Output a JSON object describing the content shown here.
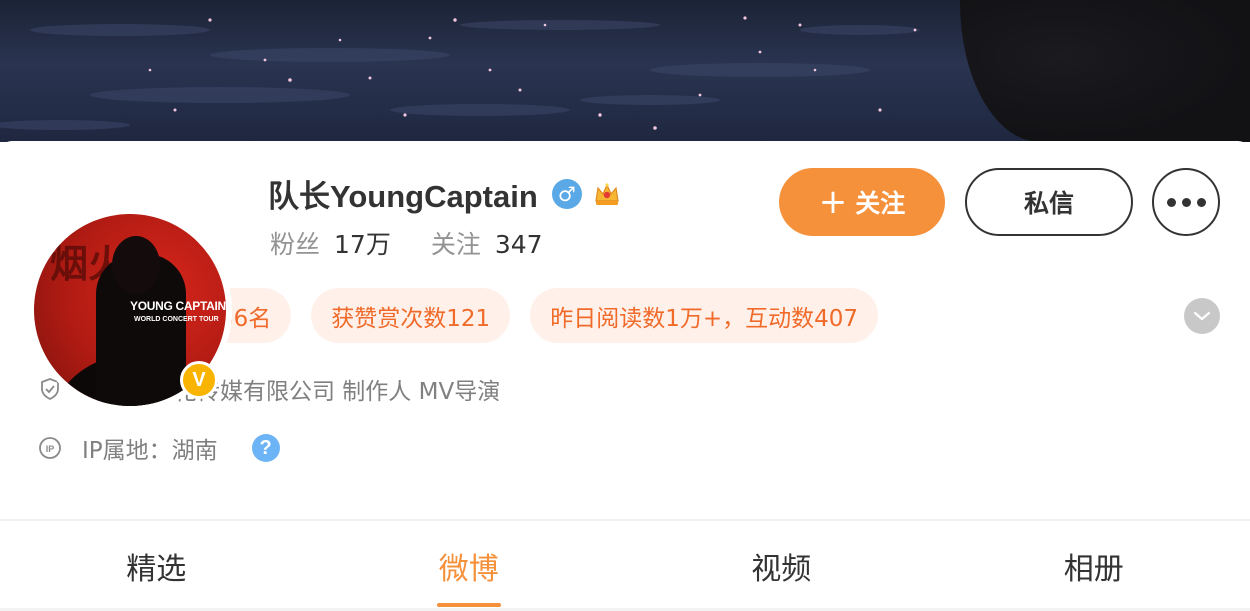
{
  "profile": {
    "name": "队长YoungCaptain",
    "gender_symbol": "♂",
    "verified_badge": "V",
    "avatar": {
      "poster_title": "YOUNG CAPTAIN",
      "poster_subtitle": "WORLD CONCERT TOUR",
      "calligraphy": "烟火"
    }
  },
  "stats": {
    "followers_label": "粉丝",
    "followers_value": "17万",
    "following_label": "关注",
    "following_value": "347"
  },
  "actions": {
    "follow_label": "关注",
    "follow_plus": "+",
    "message_label": "私信"
  },
  "tags": [
    "视频号音乐榜第56名",
    "获赞赏次数121",
    "昨日阅读数1万+，互动数407"
  ],
  "info": {
    "company": "纽曼尼文化传媒有限公司 制作人 MV导演",
    "ip_location": "IP属地：湖南",
    "help_symbol": "?"
  },
  "tabs": [
    {
      "label": "精选",
      "active": false
    },
    {
      "label": "微博",
      "active": true
    },
    {
      "label": "视频",
      "active": false
    },
    {
      "label": "相册",
      "active": false
    }
  ],
  "colors": {
    "accent": "#f5903b",
    "tag_bg": "#fff1ea",
    "tag_text": "#f06a2a",
    "verified": "#f8b400",
    "gender": "#5aa9e6"
  },
  "icons": {
    "gender": "male-icon",
    "crown": "crown-icon",
    "company": "shield-icon",
    "ip": "ip-icon",
    "help": "help-icon",
    "more": "more-dots-icon",
    "expand": "chevron-down-icon"
  }
}
